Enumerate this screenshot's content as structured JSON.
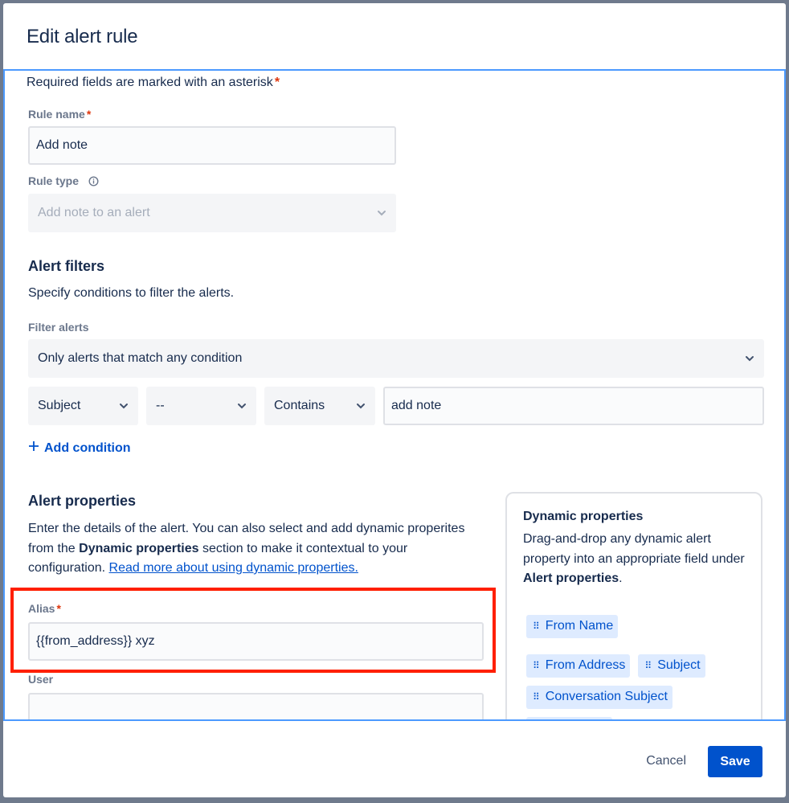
{
  "modal": {
    "title": "Edit alert rule",
    "required_note": "Required fields are marked with an asterisk",
    "asterisk": "*"
  },
  "rule_name": {
    "label": "Rule name",
    "value": "Add note"
  },
  "rule_type": {
    "label": "Rule type",
    "value": "Add note to an alert",
    "disabled": true
  },
  "alert_filters": {
    "title": "Alert filters",
    "description": "Specify conditions to filter the alerts.",
    "filter_label": "Filter alerts",
    "filter_value": "Only alerts that match any condition",
    "condition": {
      "field": "Subject",
      "not_operator": "--",
      "operator": "Contains",
      "value": "add note"
    },
    "add_condition_label": "Add condition"
  },
  "alert_properties": {
    "title": "Alert properties",
    "description_part1": "Enter the details of the alert. You can also select and add dynamic properites from the ",
    "description_bold": "Dynamic properties",
    "description_part2": " section to make it contextual to your configuration. ",
    "link_text": "Read more about using dynamic properties.",
    "alias_label": "Alias",
    "alias_value": "{{from_address}} xyz",
    "user_label": "User",
    "user_value": ""
  },
  "dynamic_properties": {
    "title": "Dynamic properties",
    "description_part1": "Drag-and-drop any dynamic alert property into an appropriate field under ",
    "description_bold": "Alert properties",
    "description_part2": ".",
    "chips": [
      "From Name",
      "From Address",
      "Subject",
      "Conversation Subject"
    ]
  },
  "footer": {
    "cancel_label": "Cancel",
    "save_label": "Save"
  },
  "colors": {
    "primary": "#0052cc",
    "required": "#de350b",
    "focus_border": "#4c9aff",
    "highlight_annotation": "#ff1f00"
  },
  "icons": {
    "info": "info-icon",
    "chevron": "chevron-down-icon",
    "plus": "plus-icon",
    "grip": "drag-handle-icon"
  }
}
